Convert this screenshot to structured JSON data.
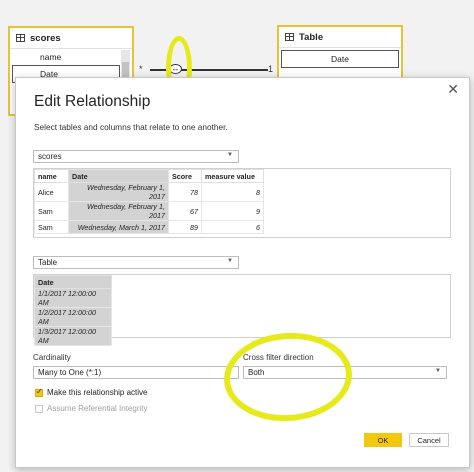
{
  "model": {
    "scores_table": {
      "title": "scores",
      "fields": [
        "name",
        "Date"
      ]
    },
    "table_table": {
      "title": "Table",
      "fields": [
        "Date"
      ]
    },
    "relationship": {
      "from_cardinality": "*",
      "to_cardinality": "1"
    }
  },
  "dialog": {
    "title": "Edit Relationship",
    "subtitle": "Select tables and columns that relate to one another.",
    "close_glyph": "✕",
    "table1": {
      "selected": "scores",
      "columns": [
        "name",
        "Date",
        "Score",
        "measure value"
      ],
      "rows": [
        [
          "Alice",
          "Wednesday, February 1, 2017",
          "78",
          "8"
        ],
        [
          "Sam",
          "Wednesday, February 1, 2017",
          "67",
          "9"
        ],
        [
          "Sam",
          "Wednesday, March 1, 2017",
          "89",
          "6"
        ]
      ]
    },
    "table2": {
      "selected": "Table",
      "columns": [
        "Date"
      ],
      "rows": [
        [
          "1/1/2017 12:00:00 AM"
        ],
        [
          "1/2/2017 12:00:00 AM"
        ],
        [
          "1/3/2017 12:00:00 AM"
        ]
      ]
    },
    "cardinality": {
      "label": "Cardinality",
      "value": "Many to One (*:1)"
    },
    "cross_filter": {
      "label": "Cross filter direction",
      "value": "Both"
    },
    "active_checkbox": {
      "label": "Make this relationship active",
      "checked": true
    },
    "integrity_checkbox": {
      "label": "Assume Referential Integrity",
      "checked": false,
      "disabled": true
    },
    "ok_label": "OK",
    "cancel_label": "Cancel"
  },
  "colors": {
    "accent": "#f2c80f",
    "highlight_marker": "#e6ea1a"
  }
}
